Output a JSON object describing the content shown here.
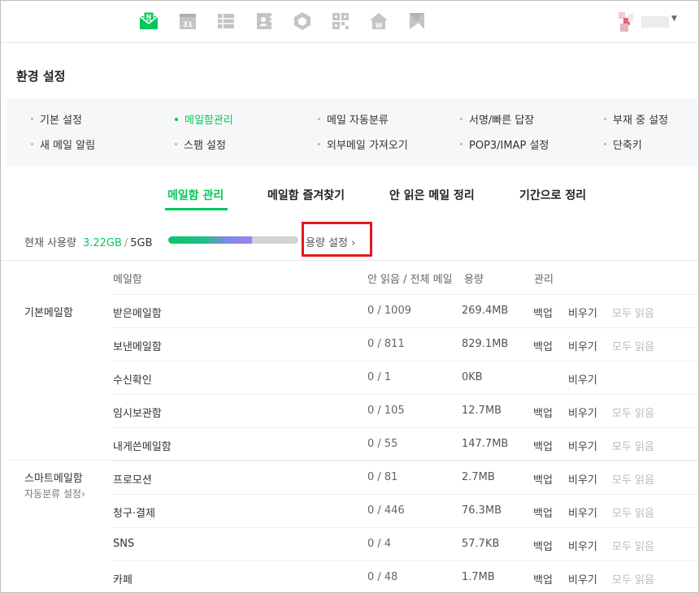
{
  "colors": {
    "accent": "#03c75a",
    "highlight": "#e4191b"
  },
  "top_nav": {
    "icons": [
      "mail-icon",
      "calendar-icon",
      "contacts-list-icon",
      "address-book-icon",
      "cube-icon",
      "qr-code-icon",
      "home-w-icon",
      "bookmark-icon"
    ],
    "calendar_day": "31",
    "mail_badge": "N"
  },
  "page": {
    "title": "환경 설정"
  },
  "settings_menu": {
    "row1": [
      "기본 설정",
      "메일함관리",
      "메일 자동분류",
      "서명/빠른 답장",
      "부재 중 설정"
    ],
    "row2": [
      "새 메일 알림",
      "스팸 설정",
      "외부메일 가져오기",
      "POP3/IMAP 설정",
      "단축키"
    ],
    "active": "메일함관리"
  },
  "tabs": [
    "메일함 관리",
    "메일함 즐겨찾기",
    "안 읽은 메일 정리",
    "기간으로 정리"
  ],
  "usage": {
    "label": "현재 사용량",
    "used": "3.22GB",
    "separator": "/",
    "total": "5GB",
    "fraction": 0.644,
    "quota_link": "용량 설정 ›"
  },
  "table": {
    "headers": {
      "mailbox": "메일함",
      "count": "안 읽음 / 전체 메일",
      "size": "용량",
      "manage": "관리"
    },
    "groups": [
      {
        "label": "기본메일함",
        "link": ""
      },
      {
        "label": "스마트메일함",
        "link": "자동분류 설정›"
      }
    ],
    "actions": {
      "backup": "백업",
      "empty": "비우기",
      "read_all": "모두 읽음"
    },
    "rows": [
      {
        "name": "받은메일함",
        "count": "0 / 1009",
        "size": "269.4MB",
        "backup": "백업",
        "empty": "비우기",
        "read_all": "모두 읽음"
      },
      {
        "name": "보낸메일함",
        "count": "0 / 811",
        "size": "829.1MB",
        "backup": "백업",
        "empty": "비우기",
        "read_all": "모두 읽음"
      },
      {
        "name": "수신확인",
        "count": "0 / 1",
        "size": "0KB",
        "backup": "",
        "empty": "비우기",
        "read_all": ""
      },
      {
        "name": "임시보관함",
        "count": "0 / 105",
        "size": "12.7MB",
        "backup": "백업",
        "empty": "비우기",
        "read_all": "모두 읽음"
      },
      {
        "name": "내게쓴메일함",
        "count": "0 / 55",
        "size": "147.7MB",
        "backup": "백업",
        "empty": "비우기",
        "read_all": "모두 읽음"
      },
      {
        "name": "프로모션",
        "count": "0 / 81",
        "size": "2.7MB",
        "backup": "백업",
        "empty": "비우기",
        "read_all": "모두 읽음"
      },
      {
        "name": "청구·결제",
        "count": "0 / 446",
        "size": "76.3MB",
        "backup": "백업",
        "empty": "비우기",
        "read_all": "모두 읽음"
      },
      {
        "name": "SNS",
        "count": "0 / 4",
        "size": "57.7KB",
        "backup": "백업",
        "empty": "비우기",
        "read_all": "모두 읽음"
      },
      {
        "name": "카페",
        "count": "0 / 48",
        "size": "1.7MB",
        "backup": "백업",
        "empty": "비우기",
        "read_all": "모두 읽음"
      }
    ]
  }
}
